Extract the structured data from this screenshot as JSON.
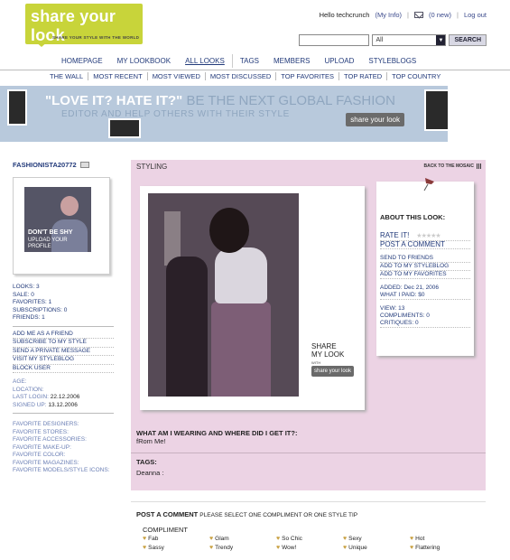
{
  "logo": {
    "text": "share your look",
    "tagline": "SHARE YOUR STYLE WITH THE WORLD"
  },
  "topbar": {
    "hello": "Hello techcrunch",
    "my_info": "(My Info)",
    "mail_count": "(0 new)",
    "logout": "Log out"
  },
  "search": {
    "value": "",
    "scope": "All",
    "button": "SEARCH"
  },
  "nav": [
    "HOMEPAGE",
    "MY LOOKBOOK",
    "ALL LOOKS",
    "TAGS",
    "MEMBERS",
    "UPLOAD",
    "STYLEBLOGS"
  ],
  "nav_active": "ALL LOOKS",
  "subnav": [
    "THE WALL",
    "MOST RECENT",
    "MOST VIEWED",
    "MOST DISCUSSED",
    "TOP FAVORITES",
    "TOP RATED",
    "TOP COUNTRY"
  ],
  "banner": {
    "line1a": "\"LOVE IT? HATE IT?\"",
    "line1b": " BE THE NEXT GLOBAL FASHION",
    "line2": "EDITOR AND HELP OTHERS WITH THEIR STYLE",
    "badge": "share your look"
  },
  "profile": {
    "username": "FASHIONISTA20772",
    "avatar_line1": "DON'T BE SHY",
    "avatar_line2": "UPLOAD YOUR PROFILE",
    "stats": [
      "LOOKS: 3",
      "SALE: 0",
      "FAVORITES: 1",
      "SUBSCRIPTIONS: 0",
      "FRIENDS: 1"
    ],
    "actions": [
      "ADD ME AS A FRIEND",
      "SUBSCRIBE TO MY STYLE",
      "SEND A PRIVATE MESSAGE",
      "VISIT MY STYLEBLOG",
      "BLOCK USER"
    ],
    "age": "AGE:",
    "location": "LOCATION:",
    "last_login_label": "LAST LOGIN:",
    "last_login": "22.12.2006",
    "signed_up_label": "SIGNED UP:",
    "signed_up": "13.12.2006",
    "favorites": [
      "FAVORITE DESIGNERS:",
      "FAVORITE STORES:",
      "FAVORITE ACCESSORIES:",
      "FAVORITE MAKE-UP:",
      "FAVORITE COLOR:",
      "FAVORITE MAGAZINES:",
      "FAVORITE MODELS/STYLE ICONS:"
    ]
  },
  "main": {
    "title": "STYLING",
    "back": "BACK TO THE MOSAIC",
    "share_line1": "SHARE",
    "share_line2": "MY LOOK",
    "share_with": "WITH",
    "share_badge": "share your look",
    "wearing_heading": "WHAT AM I WEARING AND WHERE DID I GET IT?:",
    "wearing_text": "fRom Me!",
    "tags_heading": "TAGS:",
    "tags_text": "Deanna :"
  },
  "about": {
    "title": "ABOUT THIS LOOK:",
    "rate": "RATE IT!",
    "post_comment": "POST A COMMENT",
    "send": "SEND TO FRIENDS",
    "add_styleblog": "ADD TO MY STYLEBLOG",
    "add_favorites": "ADD TO MY FAVORITES",
    "added": "ADDED: Dec 21, 2006",
    "paid": "WHAT I PAID: $0",
    "view": "VIEW: 13",
    "compliments": "COMPLIMENTS: 0",
    "critiques": "CRITIQUES: 0"
  },
  "comment": {
    "title": "POST A COMMENT",
    "hint": "PLEASE SELECT ONE COMPLIMENT OR ONE STYLE TIP",
    "compliment_label": "COMPLIMENT",
    "options": [
      "Fab",
      "Glam",
      "So Chic",
      "Sexy",
      "Hot",
      "Sassy",
      "Trendy",
      "Wow!",
      "Unique",
      "Flattering"
    ]
  },
  "colors": {
    "logo": "#c8d43a",
    "pink_panel": "#ecd3e4",
    "link": "#223a7a",
    "banner": "#b8c9dc"
  }
}
